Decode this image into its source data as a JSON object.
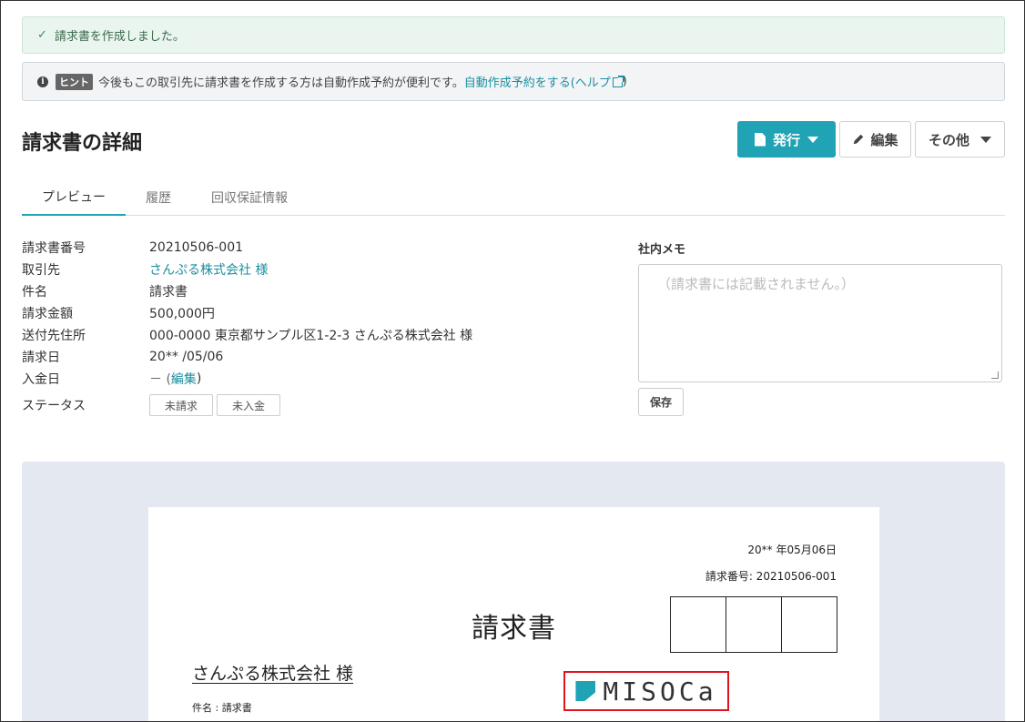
{
  "alerts": {
    "success": {
      "check": "✓",
      "text": "請求書を作成しました。"
    },
    "hint": {
      "badge": "ヒント",
      "text": "今後もこの取引先に請求書を作成する方は自動作成予約が便利です。",
      "link_text": "自動作成予約をする",
      "help_text": "(ヘルプ",
      "help_close": ")"
    }
  },
  "header": {
    "title": "請求書の詳細",
    "buttons": {
      "publish": "発行",
      "edit": "編集",
      "other": "その他"
    }
  },
  "tabs": [
    {
      "label": "プレビュー",
      "active": true
    },
    {
      "label": "履歴",
      "active": false
    },
    {
      "label": "回収保証情報",
      "active": false
    }
  ],
  "details": {
    "invoice_number": {
      "label": "請求書番号",
      "value": "20210506-001"
    },
    "client": {
      "label": "取引先",
      "value": "さんぷる株式会社 様"
    },
    "subject": {
      "label": "件名",
      "value": "請求書"
    },
    "amount": {
      "label": "請求金額",
      "value": "500,000円"
    },
    "address": {
      "label": "送付先住所",
      "value": "000-0000 東京都サンプル区1-2-3 さんぷる株式会社 様"
    },
    "invoice_date": {
      "label": "請求日",
      "value": "20** /05/06"
    },
    "payment_date": {
      "label": "入金日",
      "value": "－ (",
      "edit_link": "編集",
      "close": ")"
    },
    "status": {
      "label": "ステータス",
      "chips": [
        "未請求",
        "未入金"
      ]
    }
  },
  "memo": {
    "label": "社内メモ",
    "placeholder": "（請求書には記載されません。）",
    "save_label": "保存"
  },
  "preview": {
    "date": "20** 年05月06日",
    "number": "請求番号: 20210506-001",
    "title": "請求書",
    "client": "さんぷる株式会社 様",
    "subject": "件名 : 請求書",
    "logo_text": "MISOCa"
  },
  "colors": {
    "accent": "#1fa3b5",
    "success_bg": "#e9f5ee",
    "highlight": "#e0141e"
  }
}
